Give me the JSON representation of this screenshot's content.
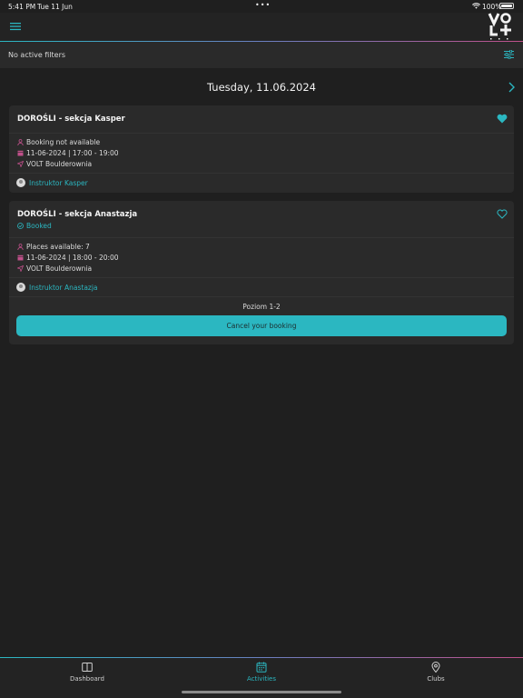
{
  "status": {
    "time": "5:41 PM",
    "date": "Tue 11 Jun",
    "battery": "100%"
  },
  "filters": {
    "label": "No active filters"
  },
  "day": {
    "title": "Tuesday, 11.06.2024"
  },
  "activities": [
    {
      "name": "DOROŚLI - sekcja Kasper",
      "availability": "Booking not available",
      "datetime": "11-06-2024 | 17:00 - 19:00",
      "location": "VOLT Boulderownia",
      "instructor": "Instruktor Kasper"
    },
    {
      "name": "DOROŚLI - sekcja Anastazja",
      "status": "Booked",
      "availability": "Places available: 7",
      "datetime": "11-06-2024 | 18:00 - 20:00",
      "location": "VOLT Boulderownia",
      "instructor": "Instruktor Anastazja",
      "level": "Poziom 1-2",
      "cancel_label": "Cancel your booking"
    }
  ],
  "tabs": [
    {
      "label": "Dashboard",
      "icon": "book-icon"
    },
    {
      "label": "Activities",
      "icon": "calendar-icon"
    },
    {
      "label": "Clubs",
      "icon": "map-pin-icon"
    }
  ],
  "colors": {
    "accent": "#2bb7c1",
    "background": "#1f1f1f",
    "card": "#2a2a2a",
    "pink_icon": "#c0508a"
  }
}
